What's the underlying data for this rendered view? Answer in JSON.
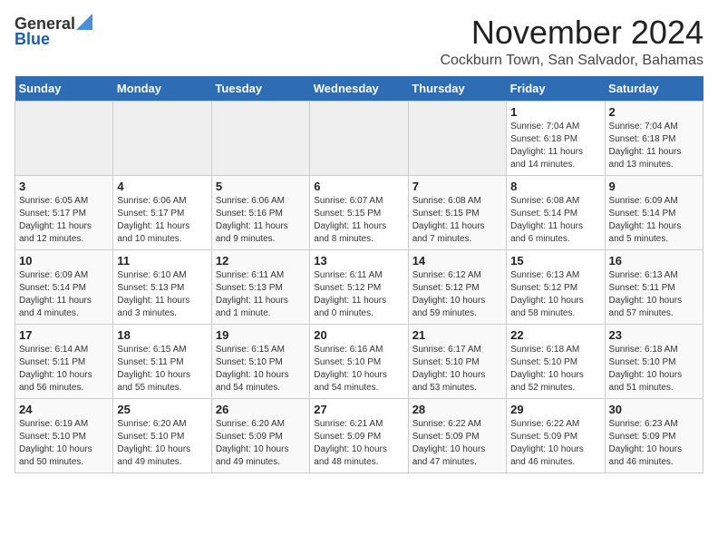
{
  "header": {
    "logo_general": "General",
    "logo_blue": "Blue",
    "month_title": "November 2024",
    "location": "Cockburn Town, San Salvador, Bahamas"
  },
  "days_of_week": [
    "Sunday",
    "Monday",
    "Tuesday",
    "Wednesday",
    "Thursday",
    "Friday",
    "Saturday"
  ],
  "weeks": [
    [
      {
        "day": "",
        "info": ""
      },
      {
        "day": "",
        "info": ""
      },
      {
        "day": "",
        "info": ""
      },
      {
        "day": "",
        "info": ""
      },
      {
        "day": "",
        "info": ""
      },
      {
        "day": "1",
        "info": "Sunrise: 7:04 AM\nSunset: 6:18 PM\nDaylight: 11 hours\nand 14 minutes."
      },
      {
        "day": "2",
        "info": "Sunrise: 7:04 AM\nSunset: 6:18 PM\nDaylight: 11 hours\nand 13 minutes."
      }
    ],
    [
      {
        "day": "3",
        "info": "Sunrise: 6:05 AM\nSunset: 5:17 PM\nDaylight: 11 hours\nand 12 minutes."
      },
      {
        "day": "4",
        "info": "Sunrise: 6:06 AM\nSunset: 5:17 PM\nDaylight: 11 hours\nand 10 minutes."
      },
      {
        "day": "5",
        "info": "Sunrise: 6:06 AM\nSunset: 5:16 PM\nDaylight: 11 hours\nand 9 minutes."
      },
      {
        "day": "6",
        "info": "Sunrise: 6:07 AM\nSunset: 5:15 PM\nDaylight: 11 hours\nand 8 minutes."
      },
      {
        "day": "7",
        "info": "Sunrise: 6:08 AM\nSunset: 5:15 PM\nDaylight: 11 hours\nand 7 minutes."
      },
      {
        "day": "8",
        "info": "Sunrise: 6:08 AM\nSunset: 5:14 PM\nDaylight: 11 hours\nand 6 minutes."
      },
      {
        "day": "9",
        "info": "Sunrise: 6:09 AM\nSunset: 5:14 PM\nDaylight: 11 hours\nand 5 minutes."
      }
    ],
    [
      {
        "day": "10",
        "info": "Sunrise: 6:09 AM\nSunset: 5:14 PM\nDaylight: 11 hours\nand 4 minutes."
      },
      {
        "day": "11",
        "info": "Sunrise: 6:10 AM\nSunset: 5:13 PM\nDaylight: 11 hours\nand 3 minutes."
      },
      {
        "day": "12",
        "info": "Sunrise: 6:11 AM\nSunset: 5:13 PM\nDaylight: 11 hours\nand 1 minute."
      },
      {
        "day": "13",
        "info": "Sunrise: 6:11 AM\nSunset: 5:12 PM\nDaylight: 11 hours\nand 0 minutes."
      },
      {
        "day": "14",
        "info": "Sunrise: 6:12 AM\nSunset: 5:12 PM\nDaylight: 10 hours\nand 59 minutes."
      },
      {
        "day": "15",
        "info": "Sunrise: 6:13 AM\nSunset: 5:12 PM\nDaylight: 10 hours\nand 58 minutes."
      },
      {
        "day": "16",
        "info": "Sunrise: 6:13 AM\nSunset: 5:11 PM\nDaylight: 10 hours\nand 57 minutes."
      }
    ],
    [
      {
        "day": "17",
        "info": "Sunrise: 6:14 AM\nSunset: 5:11 PM\nDaylight: 10 hours\nand 56 minutes."
      },
      {
        "day": "18",
        "info": "Sunrise: 6:15 AM\nSunset: 5:11 PM\nDaylight: 10 hours\nand 55 minutes."
      },
      {
        "day": "19",
        "info": "Sunrise: 6:15 AM\nSunset: 5:10 PM\nDaylight: 10 hours\nand 54 minutes."
      },
      {
        "day": "20",
        "info": "Sunrise: 6:16 AM\nSunset: 5:10 PM\nDaylight: 10 hours\nand 54 minutes."
      },
      {
        "day": "21",
        "info": "Sunrise: 6:17 AM\nSunset: 5:10 PM\nDaylight: 10 hours\nand 53 minutes."
      },
      {
        "day": "22",
        "info": "Sunrise: 6:18 AM\nSunset: 5:10 PM\nDaylight: 10 hours\nand 52 minutes."
      },
      {
        "day": "23",
        "info": "Sunrise: 6:18 AM\nSunset: 5:10 PM\nDaylight: 10 hours\nand 51 minutes."
      }
    ],
    [
      {
        "day": "24",
        "info": "Sunrise: 6:19 AM\nSunset: 5:10 PM\nDaylight: 10 hours\nand 50 minutes."
      },
      {
        "day": "25",
        "info": "Sunrise: 6:20 AM\nSunset: 5:10 PM\nDaylight: 10 hours\nand 49 minutes."
      },
      {
        "day": "26",
        "info": "Sunrise: 6:20 AM\nSunset: 5:09 PM\nDaylight: 10 hours\nand 49 minutes."
      },
      {
        "day": "27",
        "info": "Sunrise: 6:21 AM\nSunset: 5:09 PM\nDaylight: 10 hours\nand 48 minutes."
      },
      {
        "day": "28",
        "info": "Sunrise: 6:22 AM\nSunset: 5:09 PM\nDaylight: 10 hours\nand 47 minutes."
      },
      {
        "day": "29",
        "info": "Sunrise: 6:22 AM\nSunset: 5:09 PM\nDaylight: 10 hours\nand 46 minutes."
      },
      {
        "day": "30",
        "info": "Sunrise: 6:23 AM\nSunset: 5:09 PM\nDaylight: 10 hours\nand 46 minutes."
      }
    ]
  ]
}
